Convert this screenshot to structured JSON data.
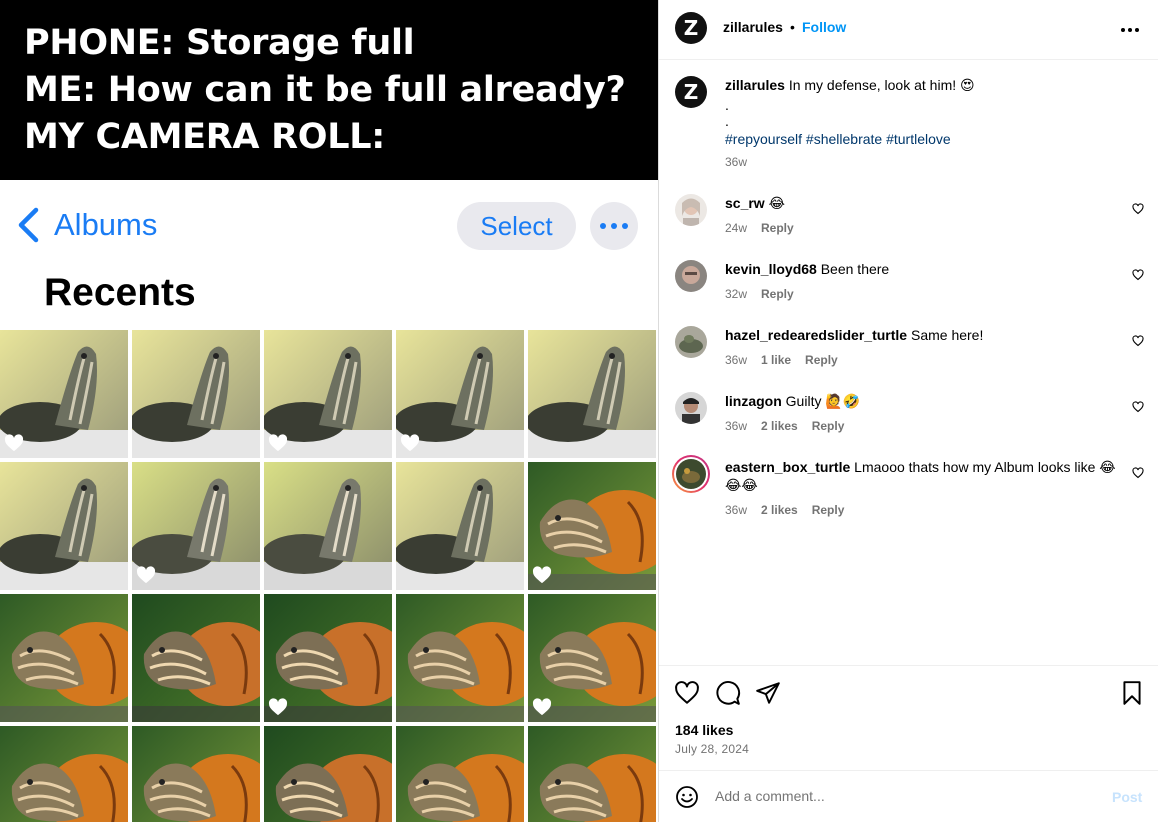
{
  "meme": {
    "caption_lines": [
      "PHONE: Storage full",
      "ME: How can it be full already?",
      "MY CAMERA ROLL:"
    ],
    "albums_label": "Albums",
    "select_label": "Select",
    "section_title": "Recents",
    "accent_color": "#1a7cf4"
  },
  "post": {
    "author": "zillarules",
    "dot": "•",
    "follow_label": "Follow",
    "avatar_letter": "Z",
    "caption_text": "In my defense, look at him! 😍",
    "caption_dots": [
      ".",
      "."
    ],
    "hashtags": "#repyourself #shellebrate #turtlelove",
    "caption_time": "36w",
    "comments": [
      {
        "user": "sc_rw",
        "text": "😂",
        "time": "24w",
        "likes": "",
        "reply": "Reply"
      },
      {
        "user": "kevin_lloyd68",
        "text": "Been there",
        "time": "32w",
        "likes": "",
        "reply": "Reply"
      },
      {
        "user": "hazel_redearedslider_turtle",
        "text": "Same here!",
        "time": "36w",
        "likes": "1 like",
        "reply": "Reply"
      },
      {
        "user": "linzagon",
        "text": "Guilty 🙋🤣",
        "time": "36w",
        "likes": "2 likes",
        "reply": "Reply"
      },
      {
        "user": "eastern_box_turtle",
        "text": "Lmaooo thats how my Album looks like 😂😂😂",
        "time": "36w",
        "likes": "2 likes",
        "reply": "Reply"
      }
    ],
    "likes": "184 likes",
    "date": "July 28, 2024",
    "add_comment_placeholder": "Add a comment...",
    "post_label": "Post",
    "colors": {
      "link": "#0095f6",
      "hashtag": "#00376b",
      "muted": "#737373"
    }
  }
}
